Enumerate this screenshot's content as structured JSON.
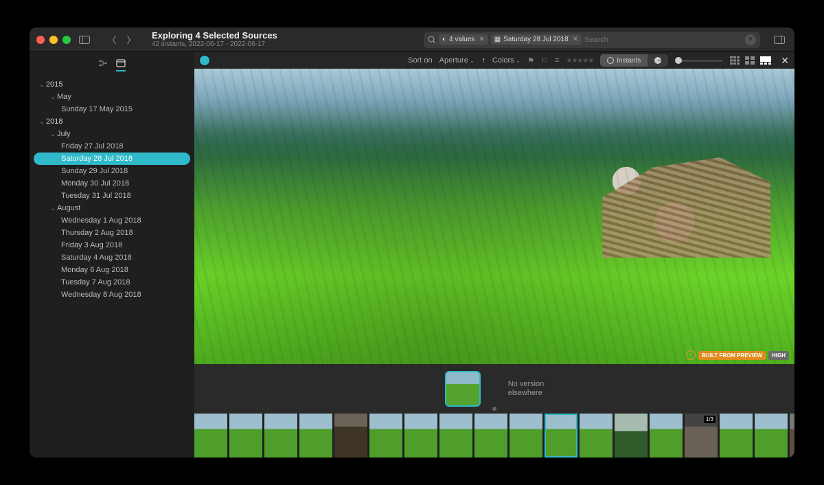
{
  "window": {
    "title": "Exploring 4 Selected Sources",
    "subtitle": "42 instants, 2022-06-17 - 2022-06-17"
  },
  "search": {
    "placeholder": "Search",
    "chips": [
      {
        "icon": "aperture-icon",
        "label": "4 values"
      },
      {
        "icon": "calendar-icon",
        "label": "Saturday 28 Jul 2018"
      }
    ]
  },
  "sidebar": {
    "tabs": [
      "tree",
      "calendar"
    ],
    "active_tab": "calendar",
    "nodes": [
      {
        "type": "year",
        "label": "2015",
        "expanded": true
      },
      {
        "type": "month",
        "label": "May",
        "expanded": true
      },
      {
        "type": "day",
        "label": "Sunday 17 May 2015"
      },
      {
        "type": "year",
        "label": "2018",
        "expanded": true
      },
      {
        "type": "month",
        "label": "July",
        "expanded": true
      },
      {
        "type": "day",
        "label": "Friday 27 Jul 2018"
      },
      {
        "type": "day",
        "label": "Saturday 28 Jul 2018",
        "selected": true
      },
      {
        "type": "day",
        "label": "Sunday 29 Jul 2018"
      },
      {
        "type": "day",
        "label": "Monday 30 Jul 2018"
      },
      {
        "type": "day",
        "label": "Tuesday 31 Jul 2018"
      },
      {
        "type": "month",
        "label": "August",
        "expanded": true
      },
      {
        "type": "day",
        "label": "Wednesday 1 Aug 2018"
      },
      {
        "type": "day",
        "label": "Thursday 2 Aug 2018"
      },
      {
        "type": "day",
        "label": "Friday 3 Aug 2018"
      },
      {
        "type": "day",
        "label": "Saturday 4 Aug 2018"
      },
      {
        "type": "day",
        "label": "Monday 6 Aug 2018"
      },
      {
        "type": "day",
        "label": "Tuesday 7 Aug 2018"
      },
      {
        "type": "day",
        "label": "Wednesday 8 Aug 2018"
      }
    ]
  },
  "toolbar": {
    "sort_label": "Sort on",
    "sort_field": "Aperture",
    "colors_label": "Colors",
    "seg_instants": "Instants",
    "badge_preview": "BUILT FROM PREVIEW",
    "badge_high": "HIGH"
  },
  "midrow": {
    "no_version_line1": "No version",
    "no_version_line2": "elsewhere"
  },
  "filmstrip": {
    "count": 18,
    "selected_index": 10,
    "counter_index": 14,
    "counter_text": "1/3"
  },
  "colors": {
    "accent": "#2fb9c9"
  }
}
